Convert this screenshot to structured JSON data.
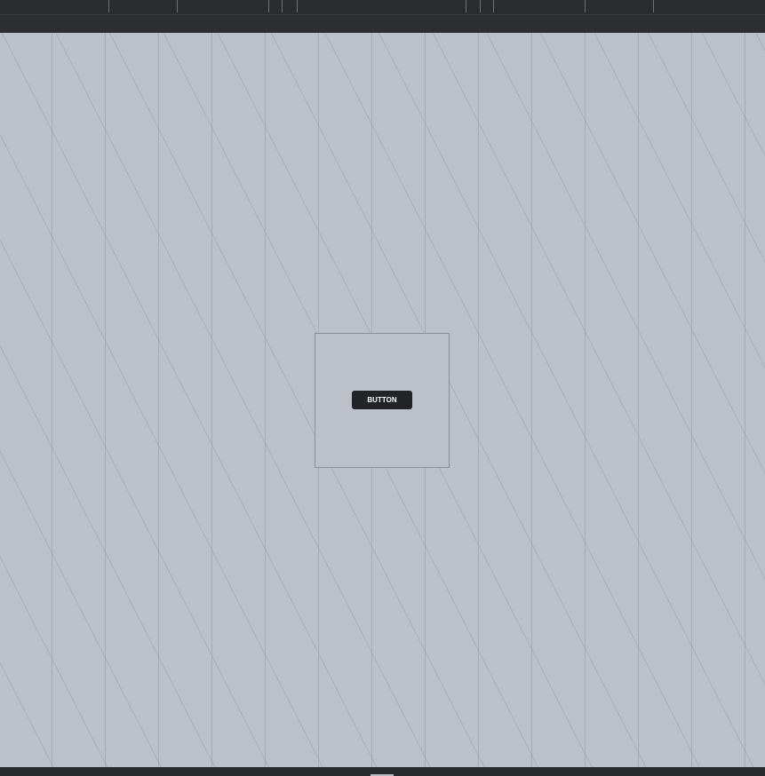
{
  "canvas": {
    "button_label": "BUTTON"
  },
  "colors": {
    "toolbar_bg": "#2b2c2f",
    "canvas_bg": "#bcc0c9",
    "button_bg": "#222326",
    "button_text": "#ffffff"
  },
  "icons": {
    "scroll": "scroll-handle"
  }
}
